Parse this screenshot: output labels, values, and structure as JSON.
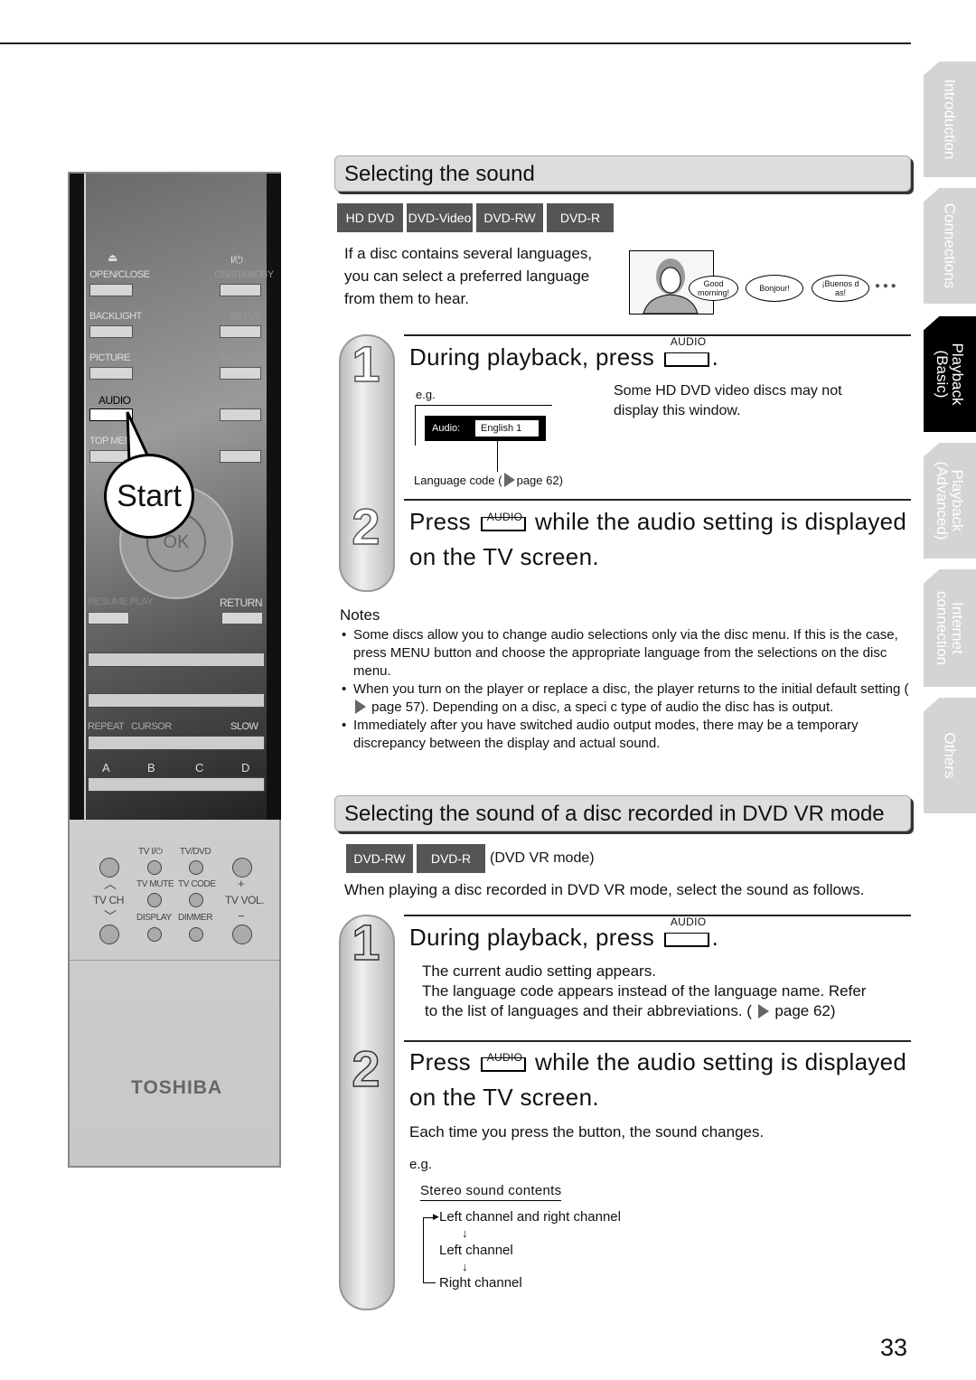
{
  "remote": {
    "labels": {
      "open_close": "OPEN/CLOSE",
      "on_standby": "ON/STANDBY",
      "power_symbol": "I/⏻",
      "backlight": "BACKLIGHT",
      "setup": "SETUP",
      "picture": "PICTURE",
      "subtitle": "SUBTITLE",
      "audio": "AUDIO",
      "angle": "ANGLE",
      "top_menu": "TOP MENU",
      "menu": "MENU",
      "ok": "OK",
      "resume_play": "RESUME PLAY",
      "return": "RETURN",
      "repeat": "REPEAT",
      "cursor": "CURSOR",
      "slow": "SLOW",
      "a": "A",
      "b": "B",
      "c": "C",
      "d": "D",
      "tv_power": "TV  I/⏻",
      "tv_dvd": "TV/DVD",
      "tv_mute": "TV MUTE",
      "tv_code": "TV CODE",
      "tv_ch": "TV CH",
      "tv_vol": "TV VOL.",
      "display": "DISPLAY",
      "dimmer": "DIMMER",
      "plus": "+",
      "minus": "−"
    },
    "callout": "Start",
    "brand": "TOSHIBA"
  },
  "section1": {
    "title": "Selecting the sound",
    "badges": [
      "HD DVD",
      "DVD-Video",
      "DVD-RW",
      "DVD-R"
    ],
    "intro": [
      "If a disc contains several languages,",
      "you can select a preferred language",
      "from them to hear."
    ],
    "bubbles": [
      "Good morning!",
      "Bonjour!",
      "¡Buenos d as!"
    ],
    "ellipsis": "● ● ●",
    "step1": {
      "number": "1",
      "text": "During playback, press",
      "button": "AUDIO",
      "suffix": ".",
      "eg": "e.g.",
      "osd_label": "Audio:",
      "osd_value": "English  1",
      "lang_code": "Language code (",
      "lang_page": "page 62)",
      "note": [
        "Some HD DVD video discs may not",
        "display this window."
      ]
    },
    "step2": {
      "number": "2",
      "text_a": "Press",
      "button": "AUDIO",
      "text_b": "while the audio setting is displayed",
      "text_c": "on the TV screen."
    }
  },
  "notes": {
    "title": "Notes",
    "items": [
      "Some discs allow you to change audio selections only via the disc menu. If this is the case, press MENU button and choose the appropriate language from the selections on the disc menu.",
      "When you turn on the player or replace a disc, the player returns to the initial default setting (",
      "Immediately after you have switched audio output modes, there may be a temporary discrepancy between the display and actual sound."
    ],
    "item2_tail": "page 57). Depending on a disc, a speci c type of audio the disc has is output."
  },
  "section2": {
    "title": "Selecting the sound of a disc recorded in DVD VR mode",
    "badges": [
      "DVD-RW",
      "DVD-R"
    ],
    "mode": "(DVD VR mode)",
    "intro": "When playing a disc recorded in DVD VR mode, select the sound as follows.",
    "step1": {
      "number": "1",
      "text": "During playback, press",
      "button": "AUDIO",
      "suffix": ".",
      "lines": [
        "The current audio setting appears.",
        "The language code appears instead of the language name. Refer",
        "to the list of languages and their abbreviations. ("
      ],
      "page": "page 62)"
    },
    "step2": {
      "number": "2",
      "text_a": "Press",
      "button": "AUDIO",
      "text_b": "while the audio setting is displayed",
      "text_c": "on the TV screen.",
      "desc": "Each time you press the button, the sound changes.",
      "eg": "e.g.",
      "stereo_title": "Stereo sound contents",
      "cycle": [
        "Left channel and right channel",
        "Left channel",
        "Right channel"
      ]
    }
  },
  "side_tabs": [
    {
      "label": "Introduction",
      "active": false
    },
    {
      "label": "Connections",
      "active": false
    },
    {
      "label": "Playback\n(Basic)",
      "active": true
    },
    {
      "label": "Playback\n(Advanced)",
      "active": false
    },
    {
      "label": "Internet\nconnection",
      "active": false
    },
    {
      "label": "Others",
      "active": false
    }
  ],
  "page_number": "33",
  "colors": {
    "badge": "#555555",
    "active_tab": "#000000",
    "inactive_tab": "#d4d4d4"
  }
}
